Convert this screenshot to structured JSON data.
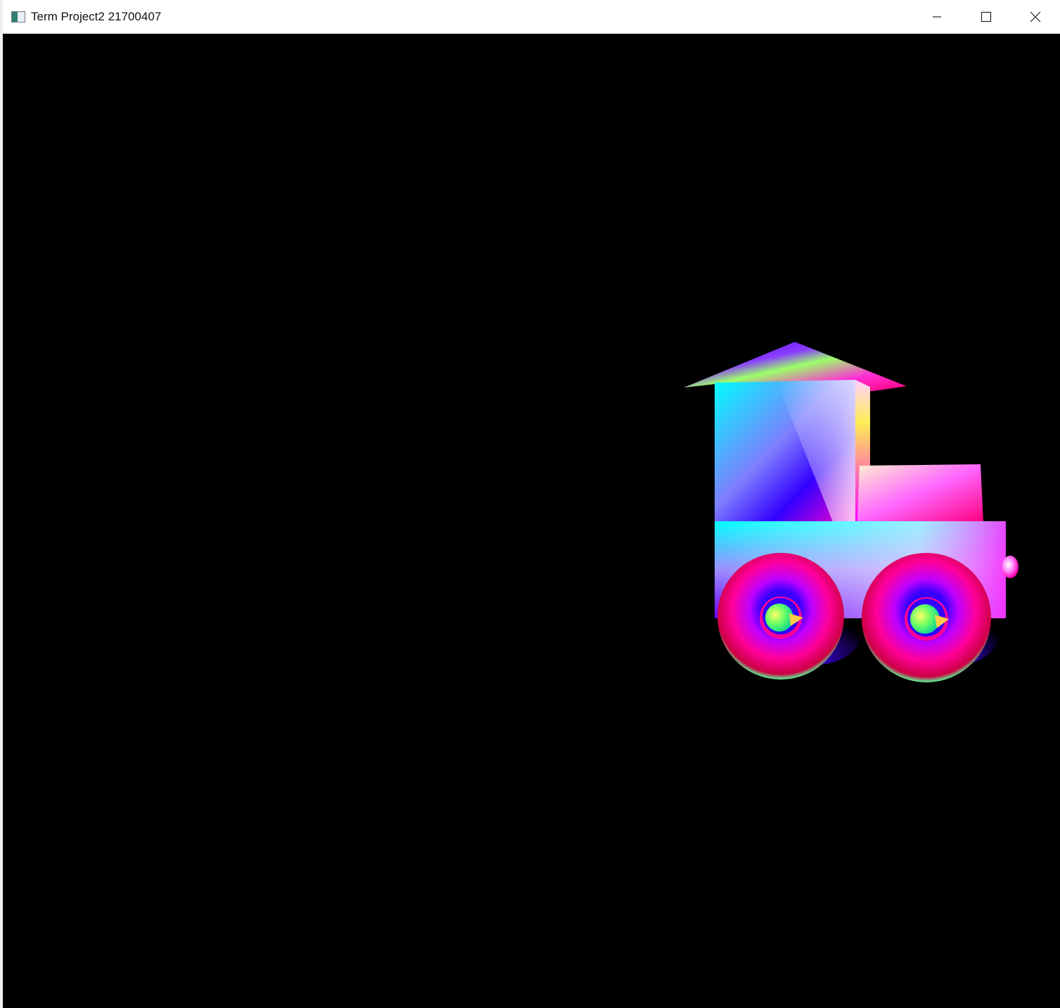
{
  "window": {
    "title": "Term Project2 21700407",
    "icon": "app-window-icon",
    "controls": [
      "minimize-icon",
      "maximize-icon",
      "close-icon"
    ]
  },
  "scene": {
    "background": "#000000",
    "object": "toy-train"
  }
}
